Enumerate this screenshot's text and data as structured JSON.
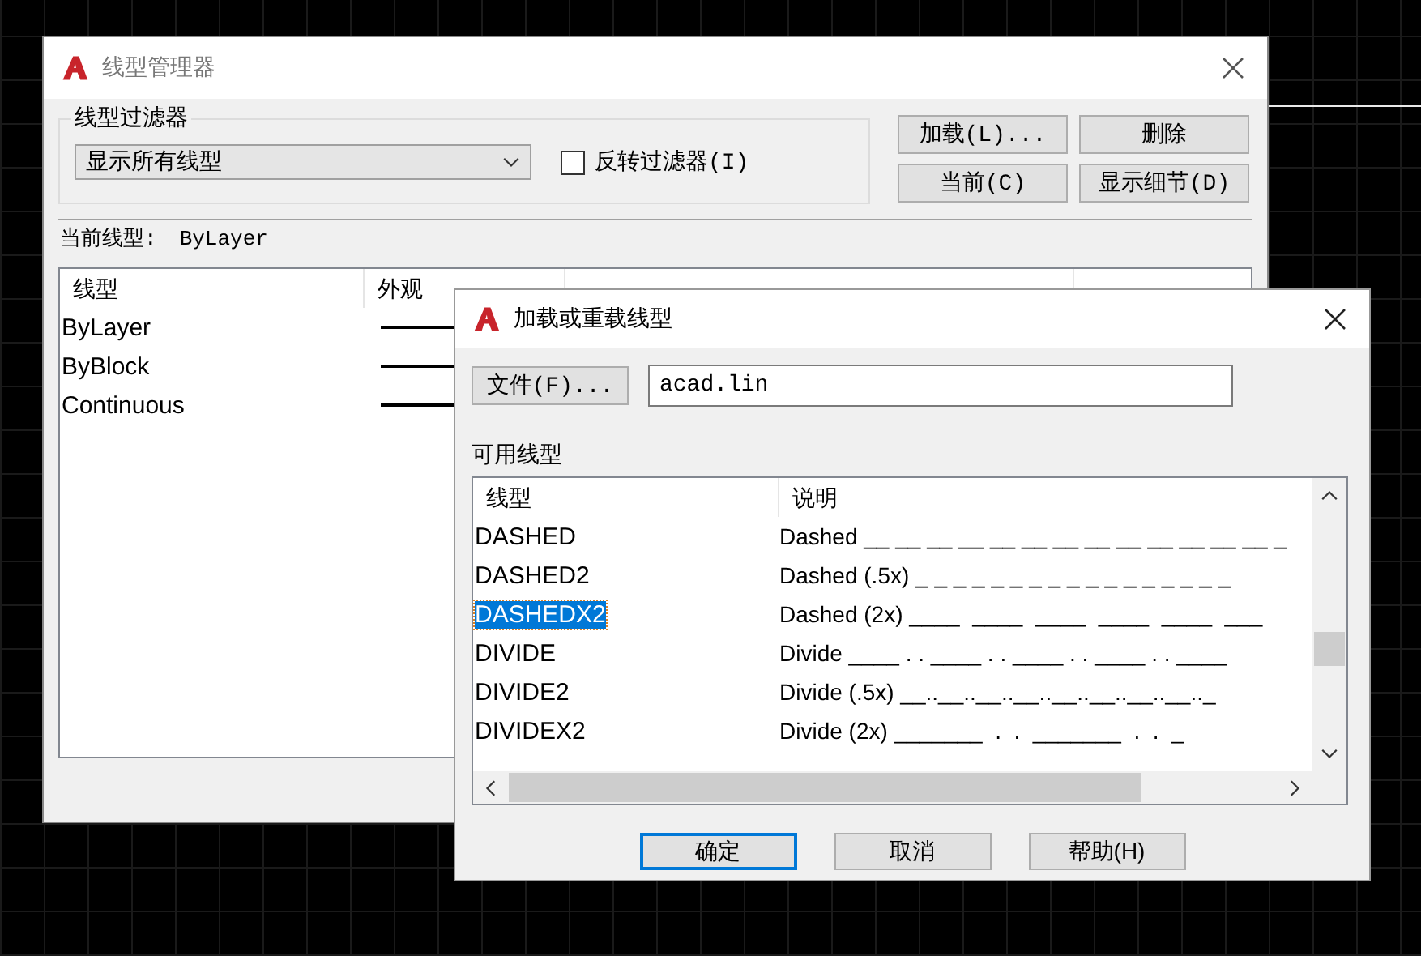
{
  "main_dialog": {
    "title": "线型管理器",
    "filter_group": {
      "label": "线型过滤器",
      "dropdown": {
        "value": "显示所有线型"
      },
      "invert_filter": {
        "label": "反转过滤器(I)",
        "checked": false
      }
    },
    "buttons": [
      {
        "label": "加载(L)..."
      },
      {
        "label": "删除"
      },
      {
        "label": "当前(C)"
      },
      {
        "label": "显示细节(D)"
      }
    ],
    "current_linetype": {
      "label": "当前线型:",
      "value": "ByLayer"
    },
    "list": {
      "columns": [
        "线型",
        "外观"
      ],
      "rows": [
        {
          "name": "ByLayer"
        },
        {
          "name": "ByBlock"
        },
        {
          "name": "Continuous"
        }
      ]
    }
  },
  "load_dialog": {
    "title": "加载或重载线型",
    "file_button": "文件(F)...",
    "file_field": {
      "value": "acad.lin"
    },
    "available_label": "可用线型",
    "list": {
      "columns": [
        "线型",
        "说明"
      ],
      "rows": [
        {
          "name": "DASHED",
          "description": "Dashed __ __ __ __ __ __ __ __ __ __ __ __ __ _",
          "selected": false
        },
        {
          "name": "DASHED2",
          "description": "Dashed (.5x) _ _ _ _ _ _ _ _ _ _ _ _ _ _ _ _ _",
          "selected": false
        },
        {
          "name": "DASHEDX2",
          "description": "Dashed (2x) ____  ____  ____  ____  ____  ___",
          "selected": true
        },
        {
          "name": "DIVIDE",
          "description": "Divide ____ . . ____ . . ____ . . ____ . . ____",
          "selected": false
        },
        {
          "name": "DIVIDE2",
          "description": "Divide (.5x) __..__..__..__..__..__..__..__.._",
          "selected": false
        },
        {
          "name": "DIVIDEX2",
          "description": "Divide (2x) _______  .  .  _______  .  .  _",
          "selected": false
        }
      ]
    },
    "buttons": [
      {
        "label": "确定",
        "focused": true
      },
      {
        "label": "取消",
        "focused": false
      },
      {
        "label": "帮助(H)",
        "focused": false
      }
    ]
  }
}
